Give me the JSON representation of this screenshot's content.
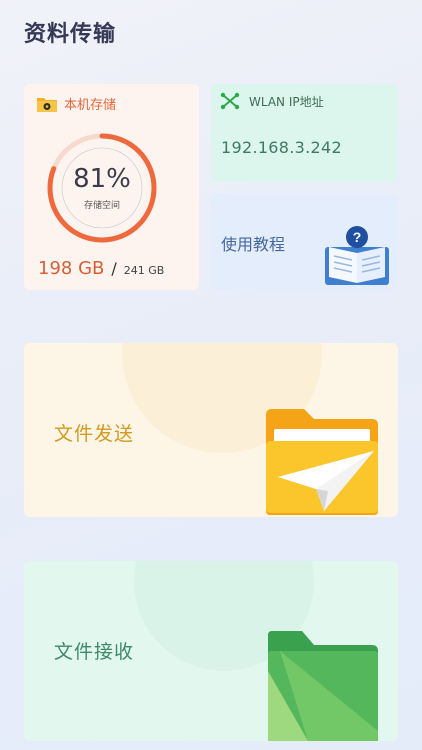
{
  "header": {
    "title": "资料传输"
  },
  "storage": {
    "title": "本机存储",
    "percent": 0.81,
    "percent_label": "81%",
    "sub_label": "存储空间",
    "used": "198 GB",
    "separator": "/",
    "total": "241 GB",
    "ring_color": "#ee6a3d",
    "ring_track_color": "#f7d9cd"
  },
  "wlan": {
    "title": "WLAN IP地址",
    "ip": "192.168.3.242"
  },
  "tutorial": {
    "label": "使用教程"
  },
  "send": {
    "label": "文件发送"
  },
  "receive": {
    "label": "文件接收"
  },
  "icons": {
    "storage": "folder-icon",
    "wlan": "network-icon",
    "tutorial": "book-help-icon",
    "send": "folder-paper-plane-icon",
    "receive": "green-folder-icon"
  }
}
